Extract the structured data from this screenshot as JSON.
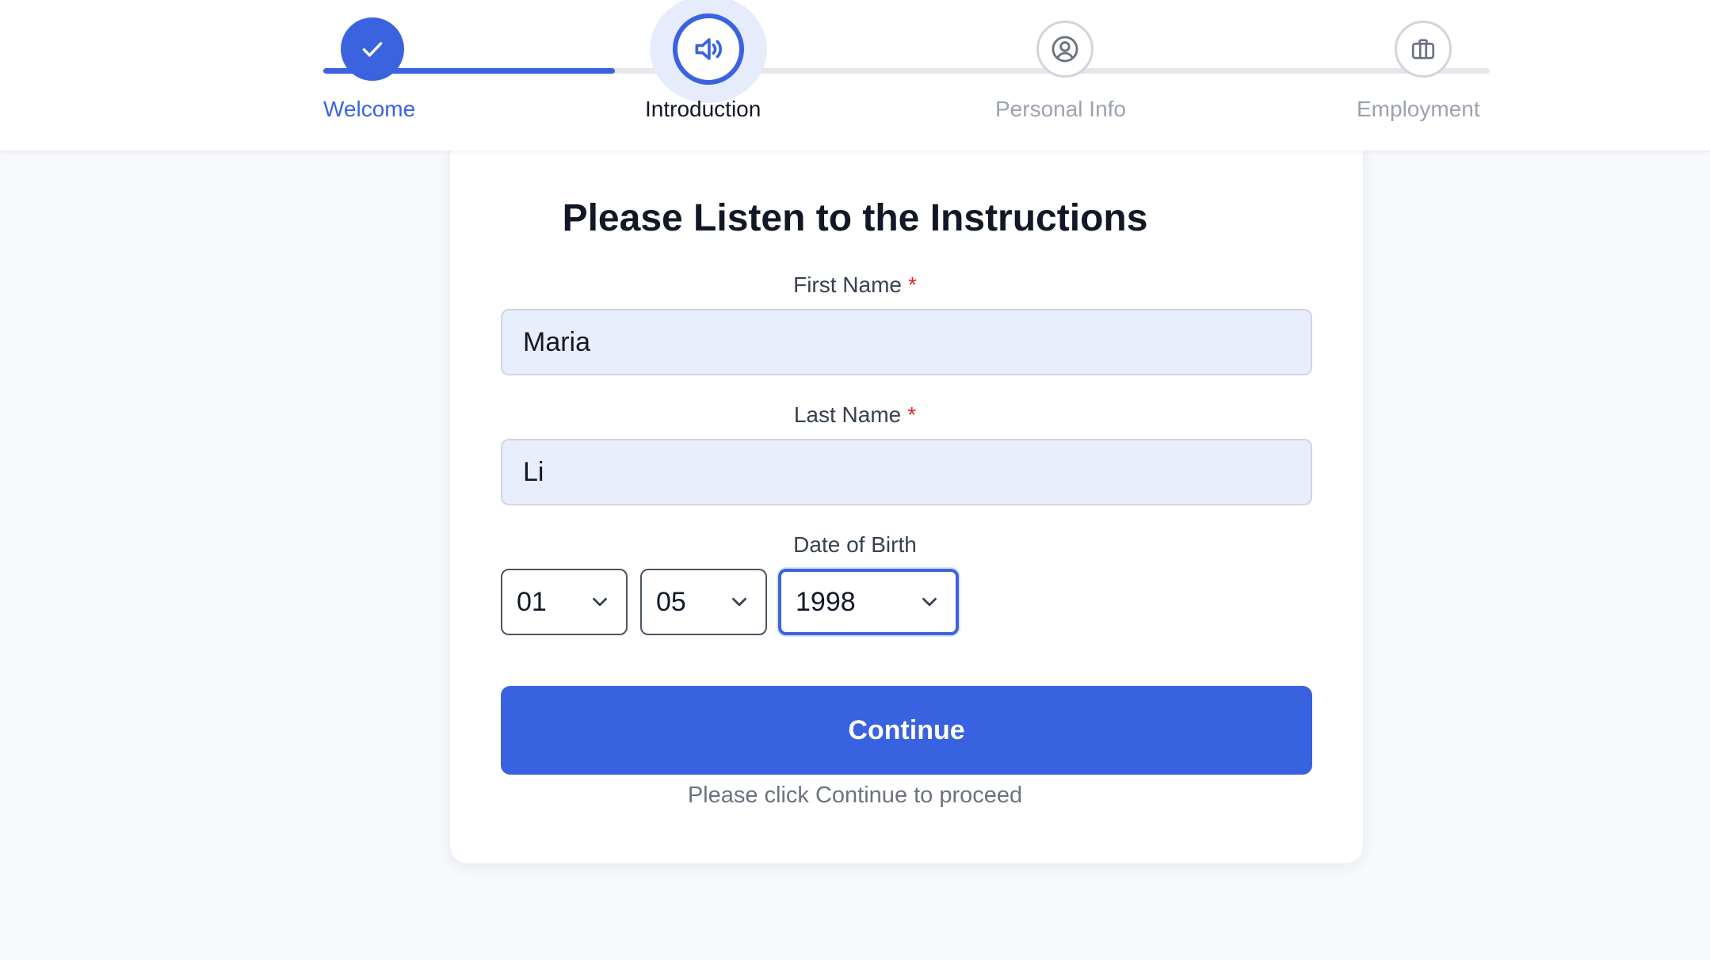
{
  "stepper": {
    "steps": [
      {
        "label": "Welcome",
        "status": "completed",
        "icon": "check-icon"
      },
      {
        "label": "Introduction",
        "status": "current",
        "icon": "speaker-icon"
      },
      {
        "label": "Personal Info",
        "status": "upcoming",
        "icon": "user-circle-icon"
      },
      {
        "label": "Employment",
        "status": "upcoming",
        "icon": "briefcase-icon"
      }
    ],
    "progress_fraction": 0.25
  },
  "form": {
    "title": "Please Listen to the Instructions",
    "first_name": {
      "label": "First Name",
      "required_mark": "*",
      "value": "Maria"
    },
    "last_name": {
      "label": "Last Name",
      "required_mark": "*",
      "value": "Li"
    },
    "dob": {
      "label": "Date of Birth",
      "day": {
        "value": "01"
      },
      "month": {
        "value": "05"
      },
      "year": {
        "value": "1998"
      }
    },
    "continue_label": "Continue",
    "hint": "Please click Continue to proceed"
  },
  "colors": {
    "accent": "#3b63e0",
    "button": "#3862e0",
    "required": "#dc2626",
    "completed_label": "#3b63e0",
    "current_label": "#111827",
    "upcoming_label": "#9ca3af",
    "upcoming_icon": "#6b7280"
  }
}
